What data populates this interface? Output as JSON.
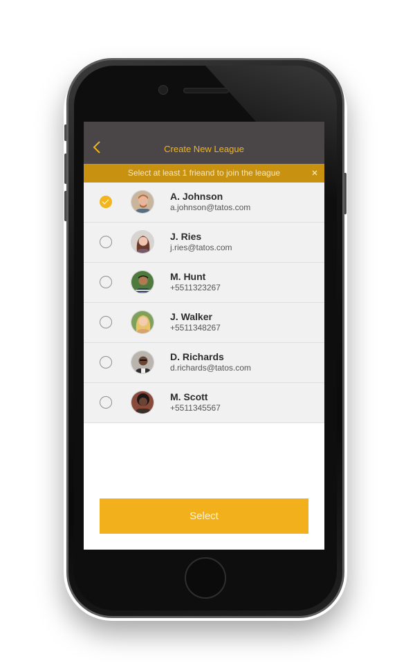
{
  "header": {
    "title": "Create New League"
  },
  "banner": {
    "text": "Select at least 1 frieand to join the league"
  },
  "friends": [
    {
      "name": "A. Johnson",
      "contact": "a.johnson@tatos.com",
      "selected": true
    },
    {
      "name": "J. Ries",
      "contact": "j.ries@tatos.com",
      "selected": false
    },
    {
      "name": "M. Hunt",
      "contact": "+5511323267",
      "selected": false
    },
    {
      "name": "J. Walker",
      "contact": "+5511348267",
      "selected": false
    },
    {
      "name": "D. Richards",
      "contact": "d.richards@tatos.com",
      "selected": false
    },
    {
      "name": "M. Scott",
      "contact": "+5511345567",
      "selected": false
    }
  ],
  "footer": {
    "select_label": "Select"
  },
  "colors": {
    "accent": "#f2b51c",
    "banner": "#c89210",
    "navbar": "#4a4648"
  },
  "icons": {
    "back": "chevron-left-icon",
    "close": "close-icon",
    "check": "checkmark-icon"
  }
}
